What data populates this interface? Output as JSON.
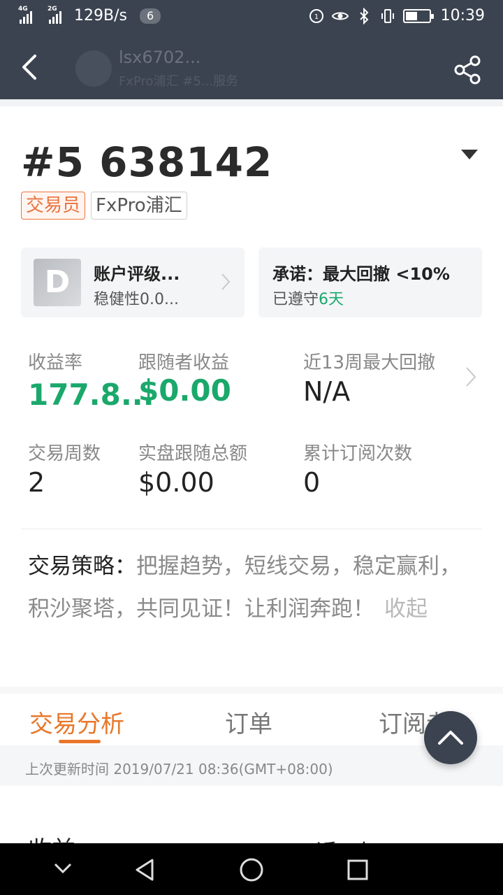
{
  "status_bar": {
    "signal1_tag": "4G",
    "signal2_tag": "2G",
    "net_speed": "129B/s",
    "notification_count": "6",
    "time": "10:39",
    "battery_level": 0.5
  },
  "nav": {
    "title": "lsx6702...",
    "subtitle": "FxPro浦汇 #5...服务",
    "back_icon": "chevron-left-icon",
    "share_icon": "share-icon"
  },
  "account": {
    "id": "#5 638142",
    "tag_role": "交易员",
    "tag_broker": "FxPro浦汇"
  },
  "rating_card": {
    "grade": "D",
    "title": "账户评级...",
    "subtitle": "稳健性0.0..."
  },
  "commit_card": {
    "title": "承诺：最大回撤 <10%",
    "subtitle_prefix": "已遵守",
    "subtitle_value": "6天"
  },
  "stats": [
    {
      "label": "收益率",
      "value": "177.8..."
    },
    {
      "label": "跟随者收益",
      "value": "$0.00"
    },
    {
      "label": "近13周最大回撤",
      "value": "N/A"
    },
    {
      "label": "交易周数",
      "value": "2"
    },
    {
      "label": "实盘跟随总额",
      "value": "$0.00"
    },
    {
      "label": "累计订阅次数",
      "value": "0"
    }
  ],
  "strategy": {
    "label": "交易策略：",
    "text": "把握趋势，短线交易，稳定赢利，积沙聚塔，共同见证！让利润奔跑！",
    "collapse": "收起"
  },
  "tabs": [
    {
      "label": "交易分析"
    },
    {
      "label": "订单"
    },
    {
      "label": "订阅者"
    }
  ],
  "update_time": "上次更新时间 2019/07/21 08:36(GMT+08:00)",
  "partial_heading": "收益",
  "partial_right": "近一年"
}
